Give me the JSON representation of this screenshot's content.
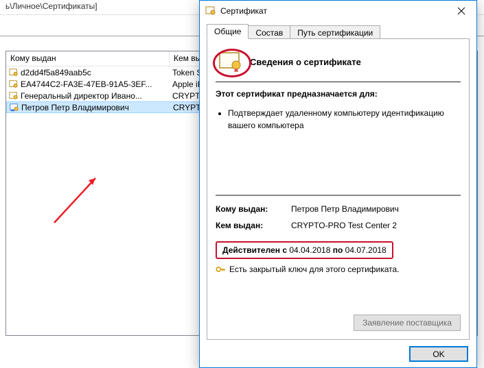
{
  "bg": {
    "title_path": "ь\\Личное\\Сертификаты]",
    "columns": {
      "issued_to": "Кому выдан",
      "issued_by": "Кем выдан"
    },
    "rows": [
      {
        "to": "d2dd4f5a849aab5c",
        "by": "Token Signin"
      },
      {
        "to": "EA4744C2-FA3E-47EB-91A5-3EF...",
        "by": "Apple iPhone"
      },
      {
        "to": "Генеральный директор Ивано...",
        "by": "CRYPTO-PRO"
      },
      {
        "to": "Петров Петр Владимирович",
        "by": "CRYPTO-PRO"
      }
    ]
  },
  "dialog": {
    "title": "Сертификат",
    "tabs": {
      "general": "Общие",
      "content": "Состав",
      "path": "Путь сертификации"
    },
    "info_title": "Сведения о сертификате",
    "purpose_title": "Этот сертификат предназначается для:",
    "purpose_item": "Подтверждает удаленному компьютеру идентификацию вашего компьютера",
    "issued_to_label": "Кому выдан:",
    "issued_to_value": "Петров Петр Владимирович",
    "issued_by_label": "Кем выдан:",
    "issued_by_value": "CRYPTO-PRO Test Center 2",
    "valid_prefix": "Действителен с",
    "valid_from": "04.04.2018",
    "valid_mid": "по",
    "valid_to": "04.07.2018",
    "private_key_text": "Есть закрытый ключ для этого сертификата.",
    "supplier_btn": "Заявление поставщика",
    "ok": "OK"
  }
}
